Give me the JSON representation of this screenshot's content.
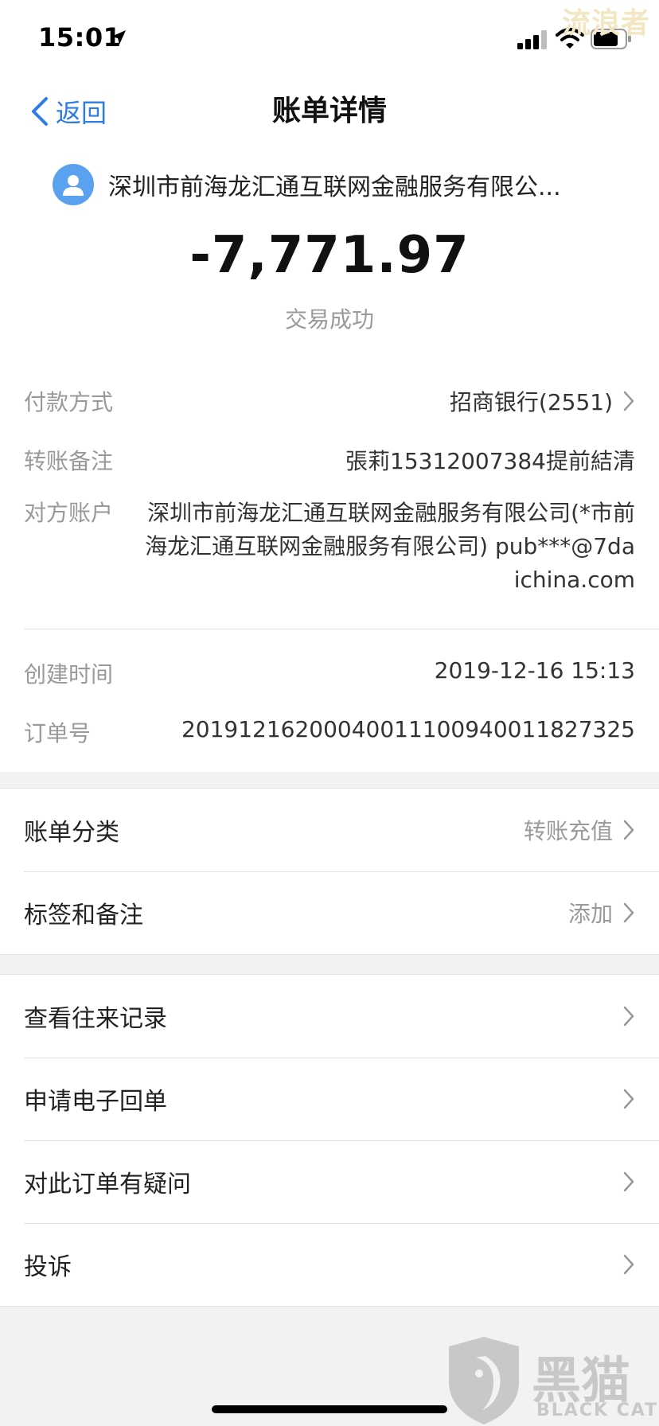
{
  "status_bar": {
    "time": "15:01"
  },
  "watermark_top": "流浪者",
  "nav": {
    "back_label": "返回",
    "title": "账单详情"
  },
  "header": {
    "merchant": "深圳市前海龙汇通互联网金融服务有限公...",
    "amount": "-7,771.97",
    "status": "交易成功"
  },
  "details": {
    "payment_method": {
      "label": "付款方式",
      "value": "招商银行(2551)"
    },
    "transfer_note": {
      "label": "转账备注",
      "value": "張莉15312007384提前結清"
    },
    "counterparty": {
      "label": "对方账户",
      "value": "深圳市前海龙汇通互联网金融服务有限公司(*市前海龙汇通互联网金融服务有限公司) pub***@7daichina.com"
    },
    "created_time": {
      "label": "创建时间",
      "value": "2019-12-16 15:13"
    },
    "order_no": {
      "label": "订单号",
      "value": "20191216200040011100940011827325"
    }
  },
  "section1": [
    {
      "label": "账单分类",
      "value": "转账充值"
    },
    {
      "label": "标签和备注",
      "value": "添加"
    }
  ],
  "section2": [
    {
      "label": "查看往来记录"
    },
    {
      "label": "申请电子回单"
    },
    {
      "label": "对此订单有疑问"
    },
    {
      "label": "投诉"
    }
  ],
  "watermark": {
    "title": "黑猫",
    "subtitle": "BLACK CAT"
  },
  "colors": {
    "accent": "#2f7ce4",
    "avatar": "#5aa2f0",
    "background": "#f2f2f4"
  }
}
